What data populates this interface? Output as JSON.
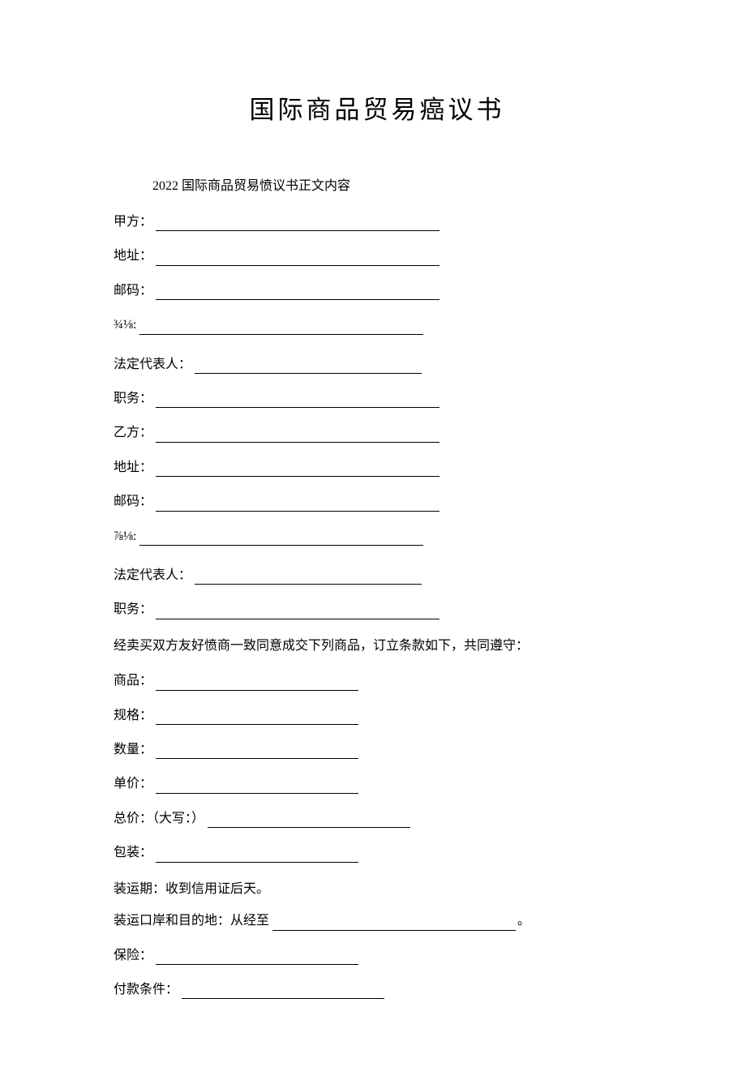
{
  "title": "国际商品贸易癌议书",
  "subtitle": "2022 国际商品贸易愤议书正文内容",
  "partyA": {
    "name_label": "甲方：",
    "address_label": "地址：",
    "postcode_label": "邮码：",
    "phone_label": "¾⅛:",
    "rep_label": "法定代表人：",
    "position_label": "职务："
  },
  "partyB": {
    "name_label": "乙方：",
    "address_label": "地址：",
    "postcode_label": "邮码：",
    "phone_label": "⅞⅛:",
    "rep_label": "法定代表人：",
    "position_label": "职务："
  },
  "body_intro": "经卖买双方友好愤商一致同意成交下列商品，订立条款如下，共同遵守：",
  "goods": {
    "product_label": "商品：",
    "spec_label": "规格：",
    "qty_label": "数量：",
    "unit_price_label": "单价：",
    "total_label": "总价：（大写：）",
    "packing_label": "包装：",
    "shipment_period": "装运期：收到信用证后天。",
    "shipment_port_prefix": "装运口岸和目的地：从经至",
    "insurance_label": "保险：",
    "payment_label": "付款条件："
  },
  "punct": {
    "period": "。"
  }
}
